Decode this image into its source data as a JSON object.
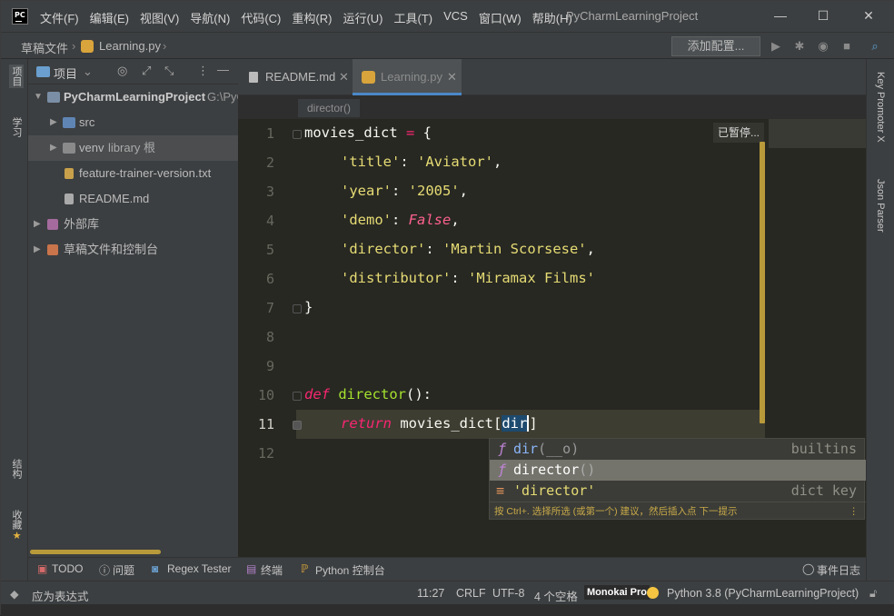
{
  "window": {
    "title": "PyCharmLearningProject",
    "logo": "PC"
  },
  "menu": [
    "文件(F)",
    "编辑(E)",
    "视图(V)",
    "导航(N)",
    "代码(C)",
    "重构(R)",
    "运行(U)",
    "工具(T)",
    "VCS",
    "窗口(W)",
    "帮助(H)"
  ],
  "nav": {
    "crumb1": "草稿文件",
    "crumb2": "Learning.py",
    "config_button": "添加配置..."
  },
  "left_strip": {
    "project": "项目",
    "learn": "学习",
    "structure": "结构",
    "favorites": "收藏"
  },
  "right_strip": {
    "key_promoter": "Key Promoter X",
    "json_parser": "Json Parser"
  },
  "project_panel": {
    "title": "项目"
  },
  "tree": [
    {
      "label": "PyCharmLearningProject",
      "suffix": "G:\\PyC"
    },
    {
      "label": "src"
    },
    {
      "label": "venv",
      "suffix": "library 根"
    },
    {
      "label": "feature-trainer-version.txt"
    },
    {
      "label": "README.md"
    },
    {
      "label": "外部库"
    },
    {
      "label": "草稿文件和控制台"
    }
  ],
  "tabs": [
    {
      "label": "README.md"
    },
    {
      "label": "Learning.py"
    }
  ],
  "editor_crumb": "director()",
  "paused_label": "已暂停...",
  "line_numbers": [
    "1",
    "2",
    "3",
    "4",
    "5",
    "6",
    "7",
    "8",
    "9",
    "10",
    "11",
    "12"
  ],
  "code": {
    "l1a": "movies_dict",
    "l1b": " = ",
    "l1c": "{",
    "l2a": "'title'",
    "l2b": ": ",
    "l2c": "'Aviator'",
    "l2d": ",",
    "l3a": "'year'",
    "l3b": ": ",
    "l3c": "'2005'",
    "l3d": ",",
    "l4a": "'demo'",
    "l4b": ": ",
    "l4c": "False",
    "l4d": ",",
    "l5a": "'director'",
    "l5b": ": ",
    "l5c": "'Martin Scorsese'",
    "l5d": ",",
    "l6a": "'distributor'",
    "l6b": ": ",
    "l6c": "'Miramax Films'",
    "l7": "}",
    "l10a": "def ",
    "l10b": "director",
    "l10c": "():",
    "l11a": "return ",
    "l11b": "movies_dict[",
    "l11c": "dir",
    "l11d": "]"
  },
  "completion": {
    "items": [
      {
        "icon": "ƒ",
        "name": "dir",
        "extra": "(__o)",
        "type": "builtins"
      },
      {
        "icon": "ƒ",
        "name": "director",
        "extra": "()",
        "type": ""
      },
      {
        "icon": "≡",
        "name": "'director'",
        "extra": "",
        "type": "dict key"
      }
    ],
    "hint": "按 Ctrl+. 选择所选 (或第一个) 建议，然后插入点 下一提示"
  },
  "bottom_tools": [
    "TODO",
    "问题",
    "Regex Tester",
    "终端",
    "Python 控制台",
    "事件日志"
  ],
  "status": {
    "left": "应为表达式",
    "position": "11:27",
    "line_sep": "CRLF",
    "encoding": "UTF-8",
    "indent": "4 个空格",
    "theme": "Monokai Pro",
    "interpreter": "Python 3.8 (PyCharmLearningProject)"
  },
  "colors": {
    "accent": "#4a88c7",
    "editor_bg": "#272822",
    "string": "#e6db74",
    "keyword": "#f92672",
    "function": "#a6e22e"
  }
}
